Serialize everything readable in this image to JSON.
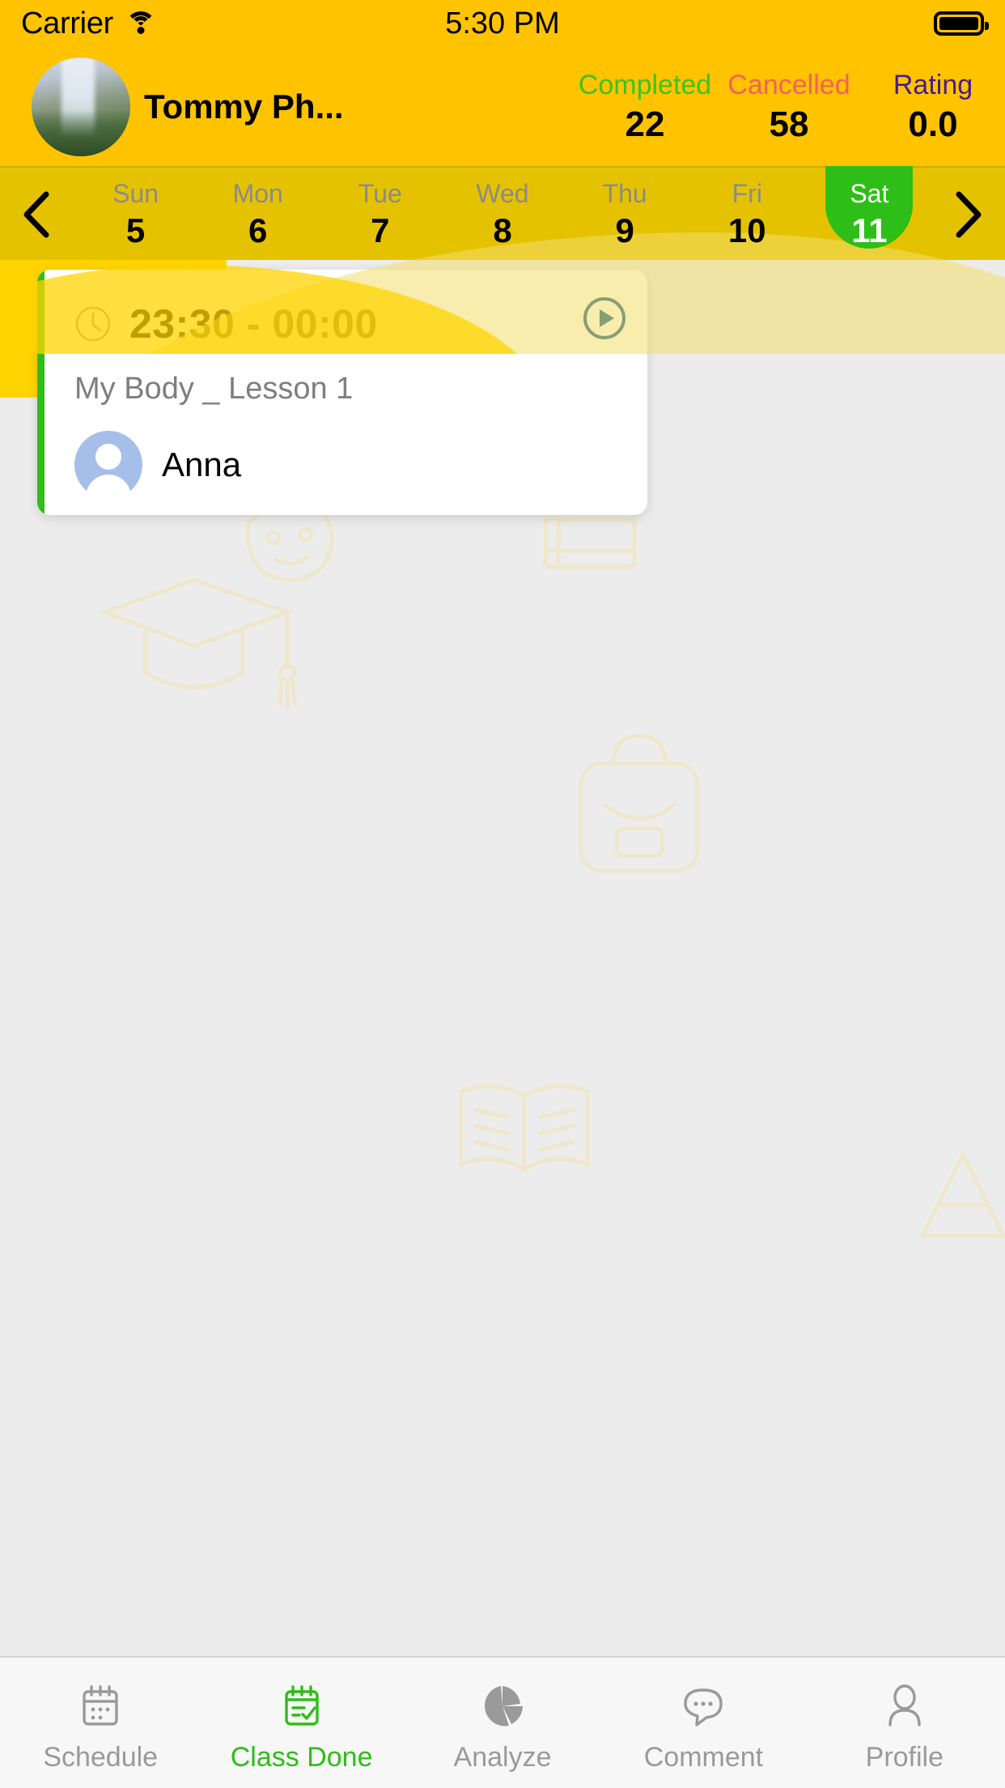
{
  "status_bar": {
    "carrier": "Carrier",
    "wifi_icon": "wifi-icon",
    "time": "5:30 PM",
    "battery_icon": "battery-full-icon"
  },
  "header": {
    "avatar_icon": "user-photo-avatar",
    "name": "Tommy Ph...",
    "background_color": "#FFC300",
    "stats": [
      {
        "label": "Completed",
        "value": "22",
        "color": "#3FC21F"
      },
      {
        "label": "Cancelled",
        "value": "58",
        "color": "#F4615C"
      },
      {
        "label": "Rating",
        "value": "0.0",
        "color": "#4B1A8C"
      }
    ]
  },
  "calendar": {
    "prev_icon": "chevron-left-icon",
    "next_icon": "chevron-right-icon",
    "background_color": "#E5C200",
    "selected_color": "#2DBE17",
    "selected_index": 6,
    "days": [
      {
        "name": "Sun",
        "date": "5"
      },
      {
        "name": "Mon",
        "date": "6"
      },
      {
        "name": "Tue",
        "date": "7"
      },
      {
        "name": "Wed",
        "date": "8"
      },
      {
        "name": "Thu",
        "date": "9"
      },
      {
        "name": "Fri",
        "date": "10"
      },
      {
        "name": "Sat",
        "date": "11"
      }
    ]
  },
  "lesson_card": {
    "accent_color": "#2DBE17",
    "clock_icon": "clock-icon",
    "time_range": "23:30 - 00:00",
    "play_icon": "play-circle-icon",
    "title": "My Body _ Lesson 1",
    "teacher_avatar_icon": "person-avatar-icon",
    "teacher_name": "Anna"
  },
  "tab_bar": {
    "active_index": 1,
    "active_color": "#2DBE17",
    "inactive_color": "#9A9A9A",
    "tabs": [
      {
        "label": "Schedule",
        "icon": "calendar-icon"
      },
      {
        "label": "Class Done",
        "icon": "checklist-icon"
      },
      {
        "label": "Analyze",
        "icon": "pie-chart-icon"
      },
      {
        "label": "Comment",
        "icon": "speech-bubble-icon"
      },
      {
        "label": "Profile",
        "icon": "person-icon"
      }
    ]
  }
}
